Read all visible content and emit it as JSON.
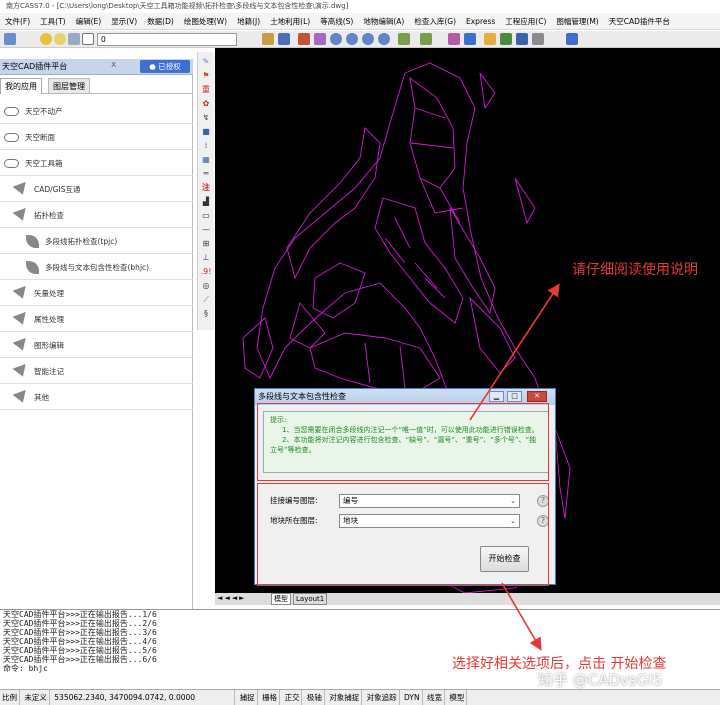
{
  "window": {
    "title": "南方CASS7.0 - [C:\\Users\\long\\Desktop\\天空工具箱功能视频\\拓扑检查\\多段线与文本包含性检查\\演示.dwg]"
  },
  "menu": [
    "文件(F)",
    "工具(T)",
    "编辑(E)",
    "显示(V)",
    "数据(D)",
    "绘图处理(W)",
    "地籍(J)",
    "土地利用(L)",
    "等高线(S)",
    "地物编辑(A)",
    "检查入库(G)",
    "Express",
    "工程应用(C)",
    "图幅管理(M)",
    "天空CAD插件平台"
  ],
  "toolbar": {
    "layer_value": "0"
  },
  "panel": {
    "title": "天空CAD插件平台",
    "close": "x",
    "auth_button": "已授权",
    "tabs": [
      "我的应用",
      "图层管理"
    ],
    "items": [
      {
        "label": "天空不动产",
        "icon": "cloud-icon",
        "level": 0
      },
      {
        "label": "天空断面",
        "icon": "cloud-icon",
        "level": 0
      },
      {
        "label": "天空工具箱",
        "icon": "cloud-icon",
        "level": 0
      },
      {
        "label": "CAD/GIS互通",
        "icon": "triangle-icon",
        "level": 1
      },
      {
        "label": "拓扑检查",
        "icon": "triangle-icon",
        "level": 1
      },
      {
        "label": "多段线拓扑检查(tpjc)",
        "icon": "leaf-icon",
        "level": 2
      },
      {
        "label": "多段线与文本包含性检查(bhjc)",
        "icon": "leaf-icon",
        "level": 2
      },
      {
        "label": "矢量处理",
        "icon": "triangle-icon",
        "level": 1
      },
      {
        "label": "属性处理",
        "icon": "triangle-icon",
        "level": 1
      },
      {
        "label": "图形编辑",
        "icon": "triangle-icon",
        "level": 1
      },
      {
        "label": "智能注记",
        "icon": "triangle-icon",
        "level": 1
      },
      {
        "label": "其他",
        "icon": "triangle-icon",
        "level": 1
      }
    ]
  },
  "side_icons": [
    "注",
    ".9!"
  ],
  "layout_tabs": [
    "模型",
    "Layout1"
  ],
  "dialog": {
    "title": "多段线与文本包含性检查",
    "hint_title": "提示:",
    "hint_lines": [
      "1、当您需要在闭合多段线内注记一个“唯一值”时，可以使用此功能进行错误检查。",
      "2、本功能将对注记内容进行包含检查、“缺号”、“漏号”、“重号”、“多个号”、“独立号”等检查。"
    ],
    "field1_label": "挂接编号图层:",
    "field1_value": "编号",
    "field2_label": "地块所在图层:",
    "field2_value": "地块",
    "help": "?",
    "start_button": "开始检查"
  },
  "command_lines": [
    "天空CAD插件平台>>>正在输出报告...1/6",
    "天空CAD插件平台>>>正在输出报告...2/6",
    "天空CAD插件平台>>>正在输出报告...3/6",
    "天空CAD插件平台>>>正在输出报告...4/6",
    "天空CAD插件平台>>>正在输出报告...5/6",
    "天空CAD插件平台>>>正在输出报告...6/6",
    "命令: bhjc"
  ],
  "statusbar": {
    "scale": "比例",
    "undefined": "未定义",
    "coords": "535062.2340, 3470094.0742, 0.0000",
    "toggles": [
      "捕捉",
      "栅格",
      "正交",
      "极轴",
      "对象捕捉",
      "对象追踪",
      "DYN",
      "线宽",
      "模型"
    ]
  },
  "annotations": {
    "top_right": "请仔细阅读使用说明",
    "bottom": "选择好相关选项后，点击 开始检查"
  },
  "watermark": "知乎 @CADvsGIS",
  "colors": {
    "polyline": "#d21bd2",
    "annotation": "#e53935",
    "hint_text": "#1a8a22"
  }
}
